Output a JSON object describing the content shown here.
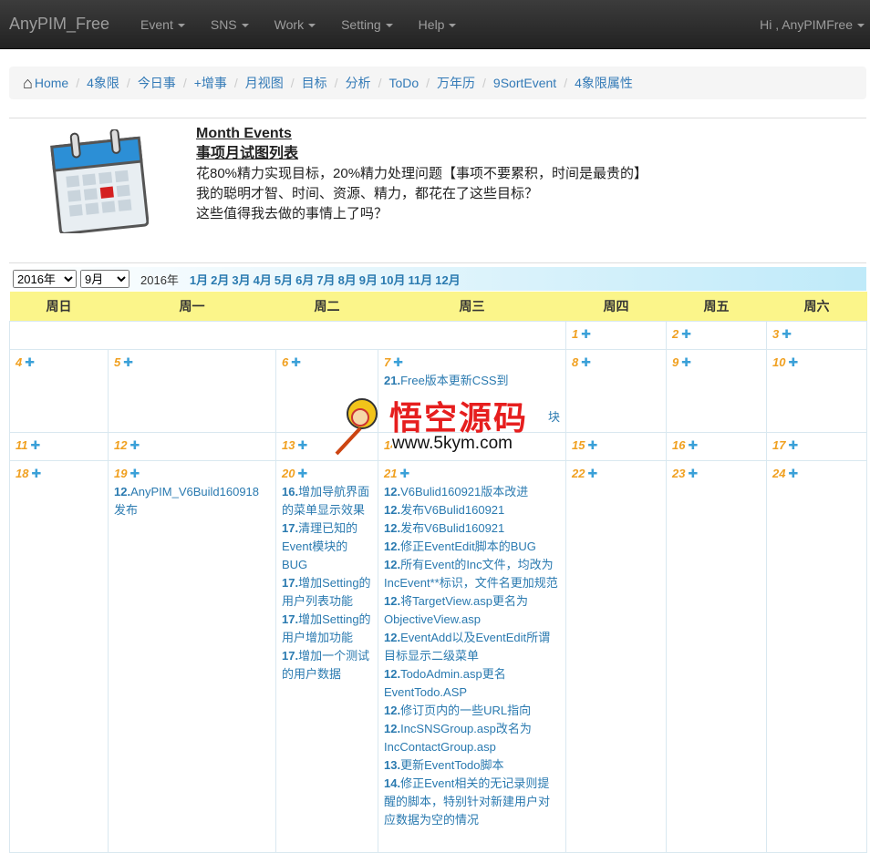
{
  "nav": {
    "brand": "AnyPIM_Free",
    "menus": [
      "Event",
      "SNS",
      "Work",
      "Setting",
      "Help"
    ],
    "user": "Hi , AnyPIMFree"
  },
  "breadcrumb": [
    "Home",
    "4象限",
    "今日事",
    "+增事",
    "月视图",
    "目标",
    "分析",
    "ToDo",
    "万年历",
    "9SortEvent",
    "4象限属性"
  ],
  "intro": {
    "title": "Month Events",
    "subtitle": "事项月试图列表",
    "lines": [
      "花80%精力实现目标，20%精力处理问题【事项不要累积，时间是最贵的】",
      "我的聪明才智、时间、资源、精力，都花在了这些目标？",
      "这些值得我去做的事情上了吗？"
    ]
  },
  "selector": {
    "year": "2016年",
    "month": "9月",
    "year_label": "2016年",
    "months": [
      "1月",
      "2月",
      "3月",
      "4月",
      "5月",
      "6月",
      "7月",
      "8月",
      "9月",
      "10月",
      "11月",
      "12月"
    ]
  },
  "weekdays": [
    "周日",
    "周一",
    "周二",
    "周三",
    "周四",
    "周五",
    "周六"
  ],
  "weeks": [
    [
      null,
      null,
      null,
      null,
      {
        "d": "1",
        "ev": []
      },
      {
        "d": "2",
        "ev": []
      },
      {
        "d": "3",
        "ev": []
      }
    ],
    [
      {
        "d": "4",
        "ev": []
      },
      {
        "d": "5",
        "ev": []
      },
      {
        "d": "6",
        "ev": []
      },
      {
        "d": "7",
        "ev": [
          [
            "21.",
            "Free版本更新CSS到"
          ],
          [
            "",
            "块"
          ]
        ]
      },
      {
        "d": "8",
        "ev": []
      },
      {
        "d": "9",
        "ev": []
      },
      {
        "d": "10",
        "ev": []
      }
    ],
    [
      {
        "d": "11",
        "ev": []
      },
      {
        "d": "12",
        "ev": []
      },
      {
        "d": "13",
        "ev": []
      },
      {
        "d": "14",
        "ev": []
      },
      {
        "d": "15",
        "ev": []
      },
      {
        "d": "16",
        "ev": []
      },
      {
        "d": "17",
        "ev": []
      }
    ],
    [
      {
        "d": "18",
        "ev": []
      },
      {
        "d": "19",
        "ev": [
          [
            "12.",
            "AnyPIM_V6Build160918发布"
          ]
        ]
      },
      {
        "d": "20",
        "ev": [
          [
            "16.",
            "增加导航界面的菜单显示效果"
          ],
          [
            "17.",
            "清理已知的Event模块的BUG"
          ],
          [
            "17.",
            "增加Setting的用户列表功能"
          ],
          [
            "17.",
            "增加Setting的用户增加功能"
          ],
          [
            "17.",
            "增加一个测试的用户数据"
          ]
        ]
      },
      {
        "d": "21",
        "ev": [
          [
            "12.",
            "V6Bulid160921版本改进"
          ],
          [
            "12.",
            "发布V6Bulid160921"
          ],
          [
            "12.",
            "发布V6Bulid160921"
          ],
          [
            "12.",
            "修正EventEdit脚本的BUG"
          ],
          [
            "12.",
            "所有Event的Inc文件，均改为IncEvent**标识，文件名更加规范"
          ],
          [
            "12.",
            "将TargetView.asp更名为ObjectiveView.asp"
          ],
          [
            "12.",
            "EventAdd以及EventEdit所谓目标显示二级菜单"
          ],
          [
            "12.",
            "TodoAdmin.asp更名EventTodo.ASP"
          ],
          [
            "12.",
            "修订页内的一些URL指向"
          ],
          [
            "12.",
            "IncSNSGroup.asp改名为IncContactGroup.asp"
          ],
          [
            "13.",
            "更新EventTodo脚本"
          ],
          [
            "14.",
            "修正Event相关的无记录则提醒的脚本，特别针对新建用户对应数据为空的情况"
          ]
        ]
      },
      {
        "d": "22",
        "ev": []
      },
      {
        "d": "23",
        "ev": []
      },
      {
        "d": "24",
        "ev": []
      }
    ]
  ],
  "watermark": {
    "text": "悟空源码",
    "url": "www.5kym.com"
  },
  "colors": {
    "navbar": "#222222",
    "weekday_header": "#fbf58a",
    "day_number": "#f0a020",
    "event_link": "#2a7ab0"
  }
}
